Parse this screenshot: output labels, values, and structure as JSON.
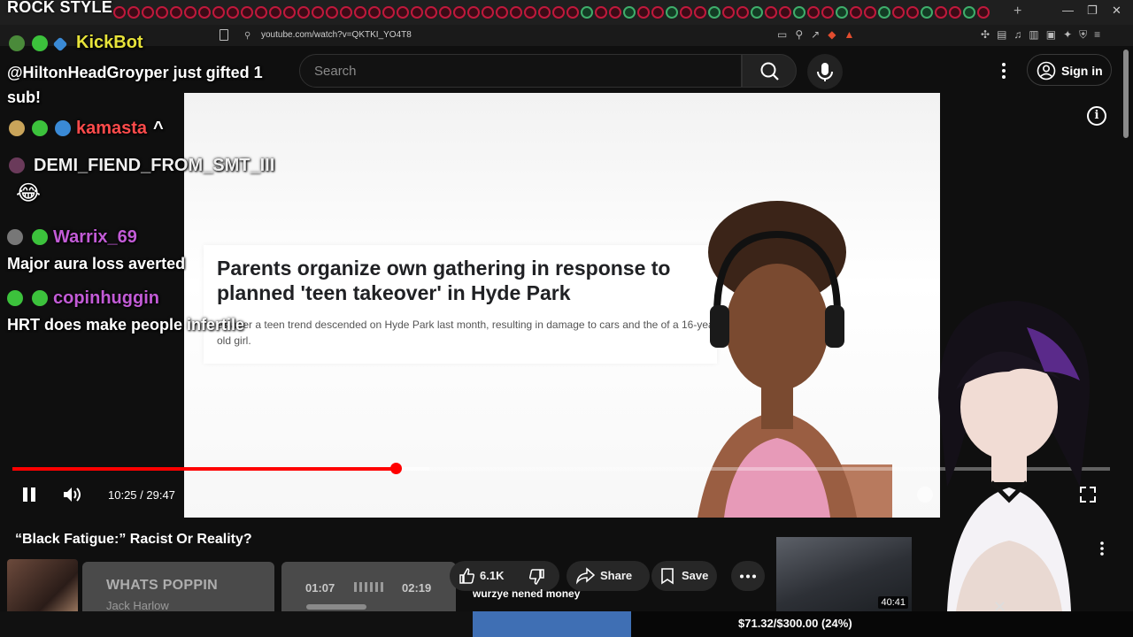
{
  "overlay": {
    "title": "ROCK STYLE",
    "chat": [
      {
        "name": "KickBot",
        "name_color": "#e7e33a",
        "message": "@HiltonHeadGroyper just gifted 1 sub!"
      },
      {
        "name": "kamasta",
        "name_color": "#ff4b4b",
        "suffix": "^",
        "message": ""
      },
      {
        "name": "DEMI_FIEND_FROM_SMT_III",
        "name_color": "#f0f0f0",
        "message": "😂"
      },
      {
        "name": "Warrix_69",
        "name_color": "#c25bd6",
        "message": "Major aura loss averted"
      },
      {
        "name": "copinhuggin",
        "name_color": "#c25bd6",
        "message": "HRT does make people infertile"
      }
    ]
  },
  "browser": {
    "url": "youtube.com/watch?v=QKTKI_YO4T8"
  },
  "youtube": {
    "search_placeholder": "Search",
    "signin_label": "Sign in"
  },
  "video": {
    "article_headline": "Parents organize own gathering in response to planned 'teen takeover' in Hyde Park",
    "article_sub": "es after a teen trend descended on Hyde Park last month, resulting in damage to cars and the of a 16-year-old girl.",
    "time_display": "10:25 / 29:47",
    "progress_fraction": 0.349,
    "buffer_fraction": 0.38,
    "title": "“Black Fatigue:” Racist Or Reality?"
  },
  "actions": {
    "likes": "6.1K",
    "share_label": "Share",
    "save_label": "Save"
  },
  "now_playing": {
    "title": "WHATS POPPIN",
    "artist": "Jack Harlow",
    "elapsed": "01:07",
    "total": "02:19",
    "progress_fraction": 0.48
  },
  "marquee": "wurzye nened money",
  "related": {
    "duration": "40:41"
  },
  "donation": {
    "label": "$71.32/$300.00 (24%)",
    "fraction": 0.24
  },
  "colors": {
    "youtube_red": "#ff0000",
    "donation_blue": "#3f6fb4"
  }
}
